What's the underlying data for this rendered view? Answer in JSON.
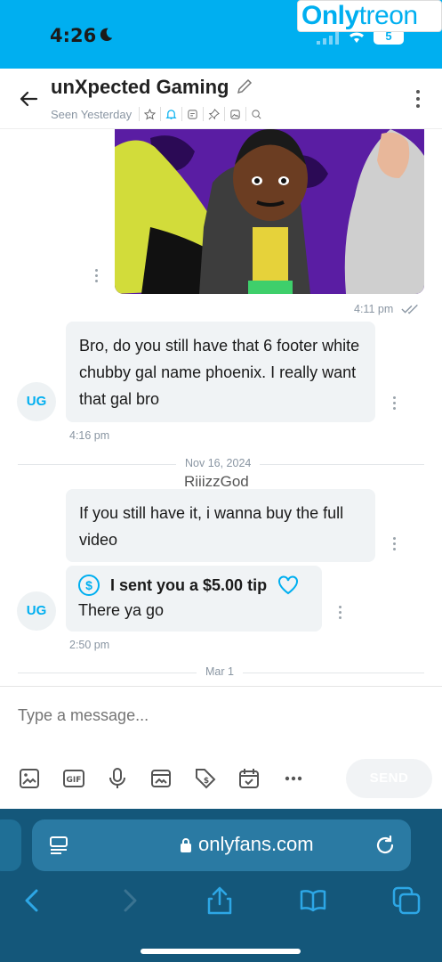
{
  "status": {
    "time": "4:26",
    "battery": "5"
  },
  "watermark": {
    "part1": "Only",
    "part2": "treon"
  },
  "header": {
    "title": "unXpected Gaming",
    "seen": "Seen Yesterday"
  },
  "messages": [
    {
      "time": "4:11 pm"
    },
    {
      "text": "Bro, do you still have that 6 footer white chubby gal name phoenix. I really want that gal bro",
      "avatar": "UG",
      "time": "4:16 pm"
    }
  ],
  "divider1": "Nov 16, 2024",
  "sender_name": "RiiizzGod",
  "messages2": [
    {
      "text": "If you still have it, i wanna buy the full video"
    },
    {
      "tip": "I sent you a $5.00 tip",
      "text": "There ya go",
      "avatar": "UG",
      "time": "2:50 pm"
    }
  ],
  "divider2": "Mar 1",
  "composer": {
    "placeholder": "Type a message...",
    "send": "SEND"
  },
  "browser": {
    "url": "onlyfans.com"
  },
  "colors": {
    "accent": "#00aff0",
    "browser": "#14577a"
  }
}
